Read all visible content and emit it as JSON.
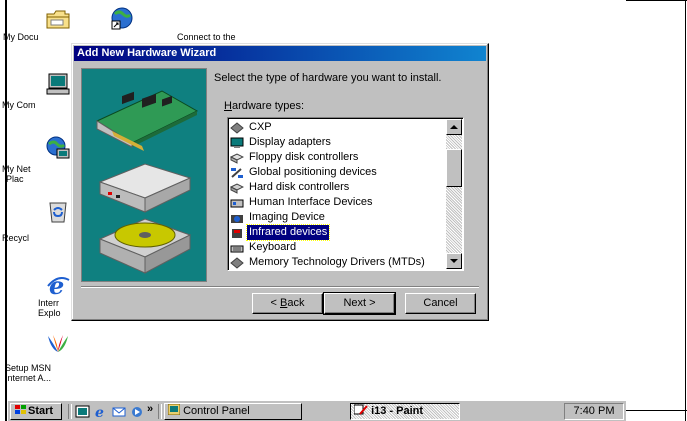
{
  "desktop": {
    "icons": [
      {
        "label": "My Documents",
        "icon": "folder-icon"
      },
      {
        "label": "Connect to the Internet",
        "icon": "connect-icon"
      },
      {
        "label": "My Computer",
        "icon": "computer-icon"
      },
      {
        "label": "My Network Places",
        "icon": "network-icon"
      },
      {
        "label": "Recycle Bin",
        "icon": "recycle-bin-icon"
      },
      {
        "label": "Internet Explorer",
        "icon": "ie-icon"
      },
      {
        "label": "Setup MSN Internet A...",
        "icon": "msn-icon"
      }
    ],
    "clipped_labels": {
      "my_documents": "My Docu",
      "connect_tail": "Connect to the",
      "my_computer": "My Com",
      "network_1": "My Net",
      "network_2": "Plac",
      "recycle": "Recycl",
      "ie_1": "Interr",
      "ie_2": "Explo",
      "msn_1": "Setup MSN",
      "msn_2": "Internet A..."
    }
  },
  "wizard": {
    "title": "Add New Hardware Wizard",
    "instruction": "Select the type of hardware you want to install.",
    "list_label": "Hardware types:",
    "list_label_accel": "H",
    "list_label_rest": "ardware types:",
    "items": [
      {
        "label": "CXP",
        "icon": "diamond-icon"
      },
      {
        "label": "Display adapters",
        "icon": "monitor-icon"
      },
      {
        "label": "Floppy disk controllers",
        "icon": "floppy-controller-icon"
      },
      {
        "label": "Global positioning devices",
        "icon": "satellite-icon"
      },
      {
        "label": "Hard disk controllers",
        "icon": "hdd-controller-icon"
      },
      {
        "label": "Human Interface Devices",
        "icon": "hid-icon"
      },
      {
        "label": "Imaging Device",
        "icon": "camera-icon"
      },
      {
        "label": "Infrared devices",
        "icon": "infrared-icon",
        "selected": true
      },
      {
        "label": "Keyboard",
        "icon": "keyboard-icon"
      },
      {
        "label": "Memory Technology Drivers (MTDs)",
        "icon": "diamond-icon"
      }
    ],
    "buttons": {
      "back": "< Back",
      "back_pre": "< ",
      "back_accel": "B",
      "back_rest": "ack",
      "next": "Next >",
      "cancel": "Cancel"
    }
  },
  "taskbar": {
    "start": "Start",
    "overflow": "»",
    "tasks": [
      {
        "label": "Control Panel",
        "active": false
      },
      {
        "label": "i13 - Paint",
        "active": true
      }
    ],
    "clock": "7:40 PM"
  },
  "colors": {
    "title_start": "#000080",
    "title_end": "#1084d0",
    "face": "#c0c0c0",
    "art_bg": "#0f8080",
    "selection": "#000080"
  }
}
